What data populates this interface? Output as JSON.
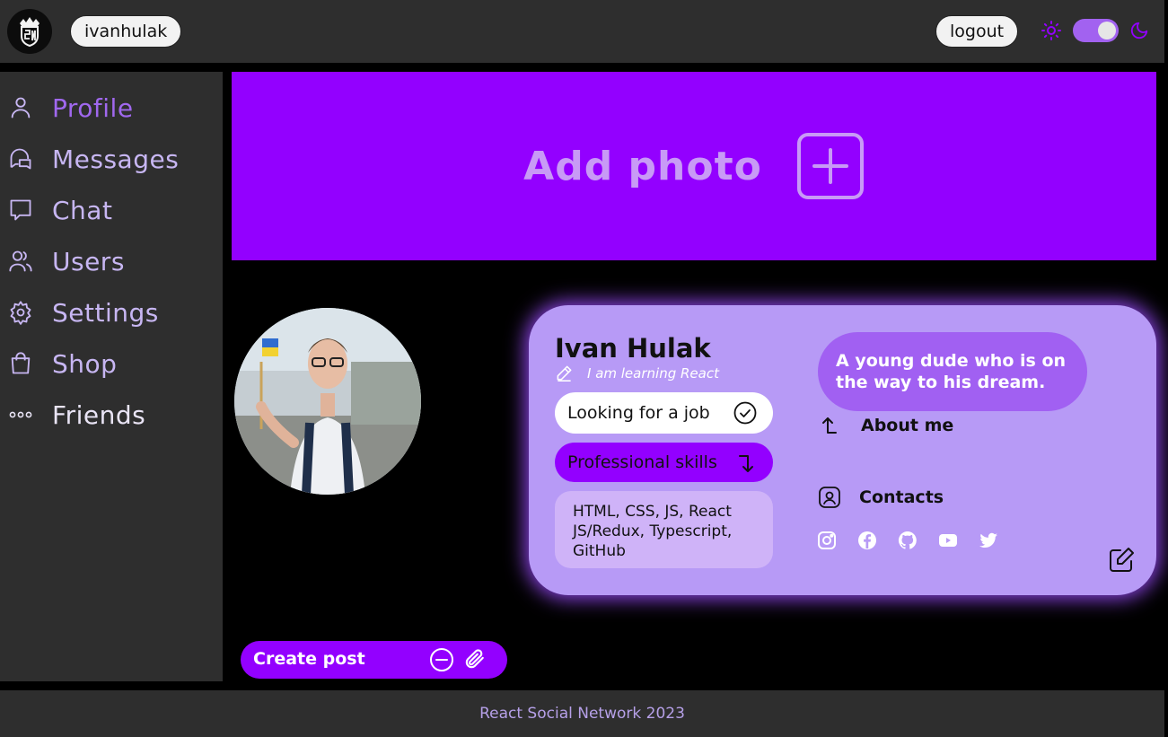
{
  "header": {
    "logo_icon": "crown-logo-icon",
    "username": "ivanhulak",
    "logout_label": "logout",
    "theme_toggle": {
      "light_icon": "sun-icon",
      "dark_icon": "moon-icon",
      "state": "dark"
    }
  },
  "sidebar": {
    "items": [
      {
        "label": "Profile",
        "icon": "user-icon"
      },
      {
        "label": "Messages",
        "icon": "messages-icon"
      },
      {
        "label": "Chat",
        "icon": "chat-icon"
      },
      {
        "label": "Users",
        "icon": "users-icon"
      },
      {
        "label": "Settings",
        "icon": "gear-icon"
      },
      {
        "label": "Shop",
        "icon": "shopping-bag-icon"
      },
      {
        "label": "Friends",
        "icon": "dots-icon"
      }
    ],
    "active": "Profile"
  },
  "cover": {
    "label": "Add photo",
    "icon": "plus-square-icon"
  },
  "profile": {
    "name": "Ivan Hulak",
    "status": "I am learning React",
    "job_label": "Looking for a job",
    "skills_label": "Professional skills",
    "skills_text": "HTML, CSS, JS, React JS/Redux, Typescript, GitHub",
    "about_text": "A young dude who is on the way to his dream.",
    "about_label": "About me",
    "contacts_label": "Contacts",
    "socials": [
      "instagram-icon",
      "facebook-icon",
      "github-icon",
      "youtube-icon",
      "twitter-icon"
    ]
  },
  "post": {
    "label": "Create post"
  },
  "footer": {
    "text": "React Social Network 2023"
  },
  "colors": {
    "accent": "#9300ff",
    "card": "#b79af6",
    "panel": "#2e2e2e",
    "nav_text": "#c7b6f2"
  }
}
